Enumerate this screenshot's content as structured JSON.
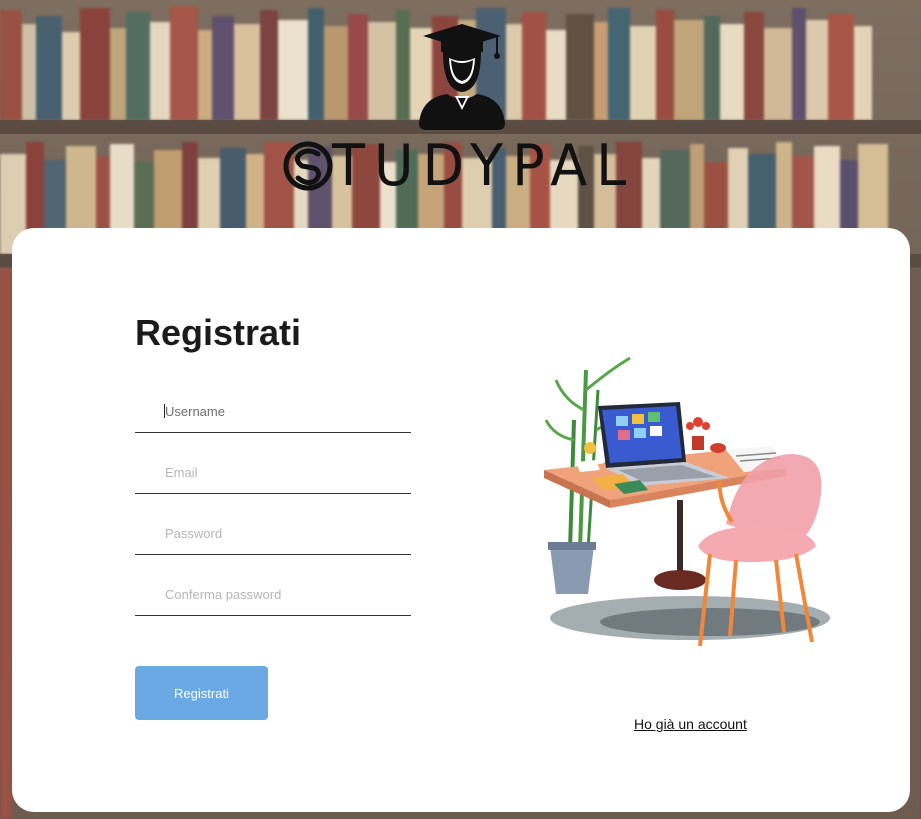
{
  "brand": {
    "name": "STUDYPAL",
    "word": "TUDYPAL"
  },
  "form": {
    "title": "Registrati",
    "fields": [
      {
        "placeholder": "Username"
      },
      {
        "placeholder": "Email"
      },
      {
        "placeholder": "Password"
      },
      {
        "placeholder": "Conferma password"
      }
    ],
    "submit_label": "Registrati",
    "login_link": "Ho già un account"
  },
  "colors": {
    "accent": "#6aa9e4",
    "card": "#ffffff",
    "text": "#1b1b1b"
  },
  "icons": {
    "logo_mark": "graduate-icon",
    "illustration": "study-desk-illustration"
  }
}
